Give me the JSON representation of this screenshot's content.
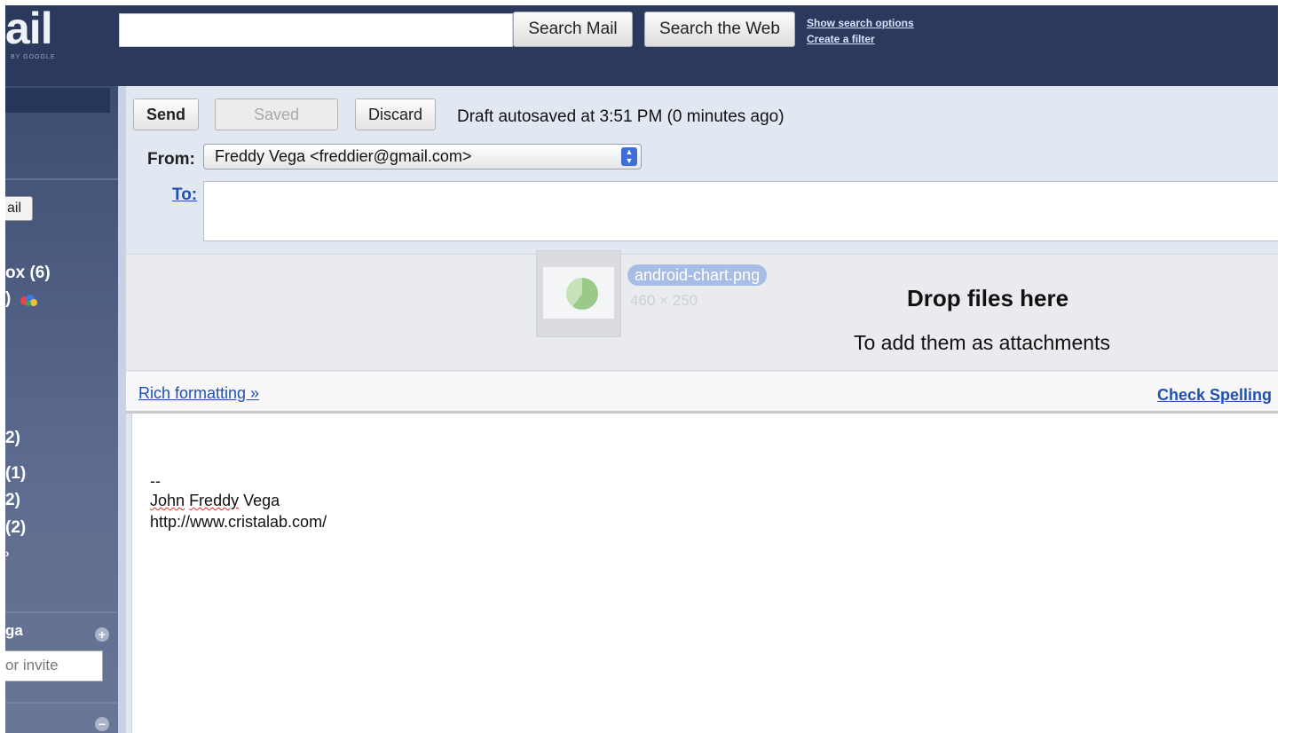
{
  "header": {
    "logo_text": "ail",
    "logo_sub": "BY GOOGLE",
    "search_value": "",
    "search_mail_label": "Search Mail",
    "search_web_label": "Search the Web",
    "show_search_options": "Show search options",
    "create_filter": "Create a filter"
  },
  "sidebar": {
    "compose_button_label": "ail",
    "items": [
      {
        "label": "ox (6)"
      },
      {
        "label": ")"
      },
      {
        "label": "2)"
      },
      {
        "label": " (1)"
      },
      {
        "label": "2)"
      },
      {
        "label": "(2)"
      },
      {
        "label": "›"
      }
    ],
    "chat_header": "ga",
    "invite_placeholder": "or invite"
  },
  "compose": {
    "send_label": "Send",
    "saved_label": "Saved",
    "discard_label": "Discard",
    "autosave_status": "Draft autosaved at 3:51 PM (0 minutes ago)",
    "from_label": "From:",
    "from_value": "Freddy Vega <freddier@gmail.com>",
    "to_label": "To:",
    "to_value": "",
    "drag": {
      "file_name": "android-chart.png",
      "file_dims": "460 × 250"
    },
    "drop_title": "Drop files here",
    "drop_sub": "To add them as attachments",
    "rich_formatting": "Rich formatting »",
    "check_spelling": "Check Spelling",
    "signature": {
      "dashes": "--",
      "name_first": "John",
      "name_middle": "Freddy",
      "name_last": "Vega",
      "url": "http://www.cristalab.com/"
    }
  },
  "colors": {
    "header_bg": "#2b3a5c",
    "compose_bg": "#e2e8f1",
    "link": "#2050b0"
  }
}
